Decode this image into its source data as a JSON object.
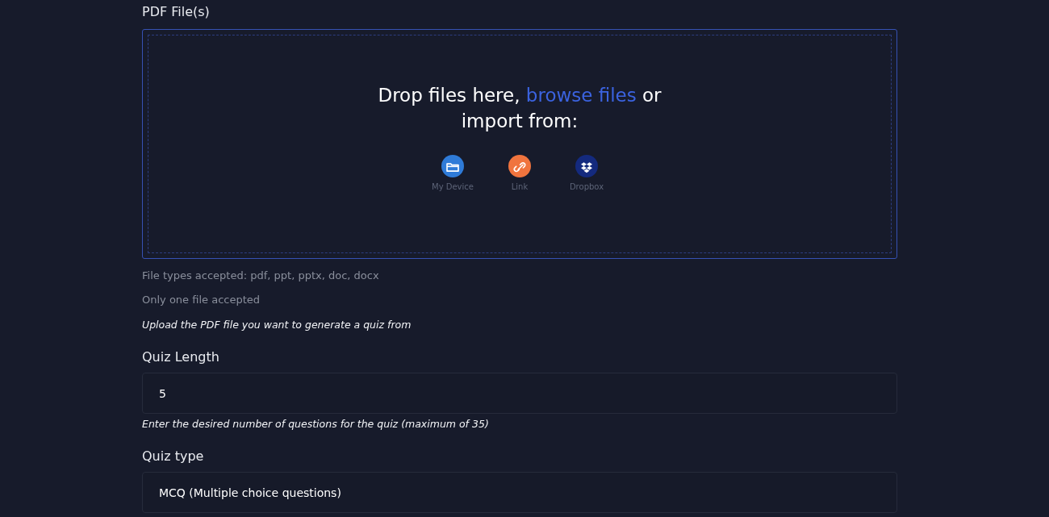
{
  "file_field": {
    "label": "PDF File(s)",
    "dropzone": {
      "text_before": "Drop files here, ",
      "link": "browse files",
      "text_after": " or import from:",
      "sources": [
        {
          "kind": "device",
          "label": "My Device",
          "color": "#2f7bd8"
        },
        {
          "kind": "link",
          "label": "Link",
          "color": "#f0743e"
        },
        {
          "kind": "dropbox",
          "label": "Dropbox",
          "color": "#142a7e"
        }
      ]
    },
    "hints": [
      "File types accepted: pdf, ppt, pptx, doc, docx",
      "Only one file accepted"
    ],
    "description": "Upload the PDF file you want to generate a quiz from"
  },
  "quiz_length": {
    "label": "Quiz Length",
    "value": "5",
    "description": "Enter the desired number of questions for the quiz (maximum of 35)"
  },
  "quiz_type": {
    "label": "Quiz type",
    "value": "MCQ (Multiple choice questions)"
  }
}
